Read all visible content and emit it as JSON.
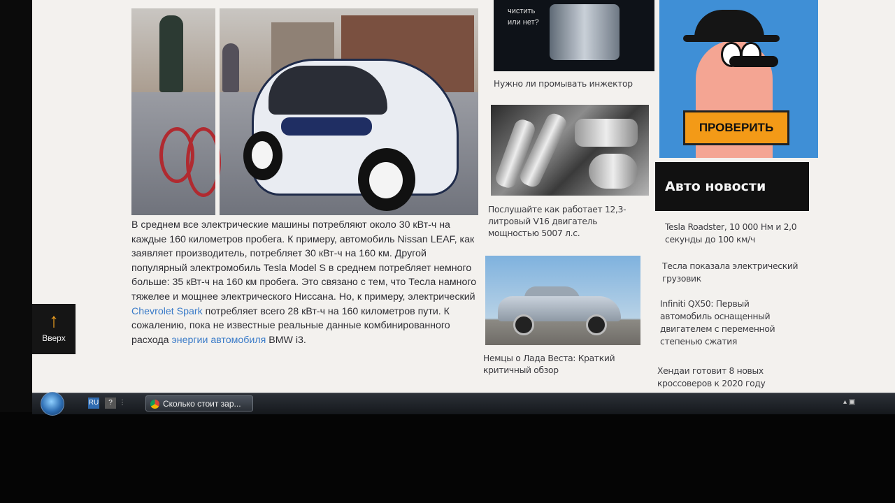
{
  "article": {
    "p1": "В среднем все электрические машины потребляют около 30 кВт-ч на каждые 160 километров пробега. К примеру, автомобиль Nissan LEAF, как заявляет производитель, потребляет 30 кВт-ч на 160 км. Другой популярный электромобиль Tesla Model S в среднем потребляет немного больше: 35 кВт-ч на 160 км пробега. Это связано с тем, что Тесла намного тяжелее и мощнее электрического Ниссана. Но, к примеру, электрический ",
    "link1": "Chevrolet Spark",
    "p2": " потребляет всего 28 кВт-ч на 160 километров пути. К сожалению, пока не известные реальные данные комбинированного расхода ",
    "link2": "энергии автомобиля",
    "p3": " BMW i3."
  },
  "up_button": {
    "arrow": "↑",
    "label": "Вверх"
  },
  "middle": {
    "thumb1_text": "чистить\nили нет?",
    "cap1": "Нужно ли промывать инжектор",
    "cap2": "Послушайте как работает 12,3-литровый V16 двигатель мощностью 5007 л.с.",
    "cap3": "Немцы о Лада Веста: Краткий критичный обзор"
  },
  "ad": {
    "button_label": "ПРОВЕРИТЬ"
  },
  "news": {
    "heading": "Авто новости",
    "items": [
      "Tesla Roadster, 10 000 Нм и 2,0 секунды до 100 км/ч",
      "Тесла показала электрический грузовик",
      "Infiniti QX50: Первый автомобиль оснащенный двигателем с переменной степенью сжатия",
      "Хендаи готовит 8 новых кроссоверов к 2020 году"
    ]
  },
  "taskbar": {
    "ql1": "RU",
    "ql2": "?",
    "task_label": "Сколько стоит зар...",
    "tray": "▴ ▣"
  }
}
